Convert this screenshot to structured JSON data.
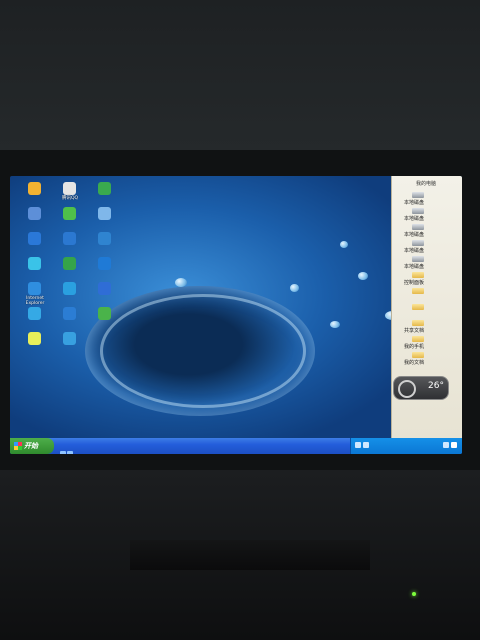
{
  "desktop_icons": [
    {
      "label": "",
      "color": "#f2b232",
      "icon": "folder-icon"
    },
    {
      "label": "腾讯QQ",
      "color": "#e5e5e5",
      "icon": "qq-penguin-icon"
    },
    {
      "label": "",
      "color": "#3aaa4f",
      "icon": "app-icon"
    },
    {
      "label": "",
      "color": "#5d8fd8",
      "icon": "computer-icon"
    },
    {
      "label": "",
      "color": "#4fc04a",
      "icon": "monitor-icon"
    },
    {
      "label": "",
      "color": "#7fb7ea",
      "icon": "app-icon"
    },
    {
      "label": "",
      "color": "#2a78d8",
      "icon": "network-icon"
    },
    {
      "label": "",
      "color": "#2b78d1",
      "icon": "browser-icon"
    },
    {
      "label": "",
      "color": "#2f84d0",
      "icon": "browser-icon"
    },
    {
      "label": "",
      "color": "#3ac3e8",
      "icon": "app-icon"
    },
    {
      "label": "",
      "color": "#35a44a",
      "icon": "game-icon"
    },
    {
      "label": "",
      "color": "#1f7ad6",
      "icon": "app-icon"
    },
    {
      "label": "Internet Explorer",
      "color": "#2f8ee0",
      "icon": "ie-icon"
    },
    {
      "label": "",
      "color": "#2aa0e0",
      "icon": "app-icon"
    },
    {
      "label": "",
      "color": "#2f6dd6",
      "icon": "app-icon"
    },
    {
      "label": "",
      "color": "#35a9e5",
      "icon": "app-icon"
    },
    {
      "label": "",
      "color": "#2b7dd4",
      "icon": "app-icon"
    },
    {
      "label": "",
      "color": "#4ab34a",
      "icon": "app-icon"
    },
    {
      "label": "",
      "color": "#e8ef5a",
      "icon": "app-icon"
    },
    {
      "label": "",
      "color": "#38a0e0",
      "icon": "app-icon"
    }
  ],
  "side_panel": {
    "title": "我的电脑",
    "drives": [
      "本地磁盘",
      "本地磁盘",
      "本地磁盘",
      "本地磁盘",
      "本地磁盘"
    ],
    "extra": [
      "控制面板",
      "",
      "",
      "共享文档",
      "我的手机",
      "我的文档"
    ],
    "gadget_value": "26°"
  },
  "taskbar": {
    "start_label": "开始",
    "weather": "",
    "clock": "",
    "date": ""
  }
}
